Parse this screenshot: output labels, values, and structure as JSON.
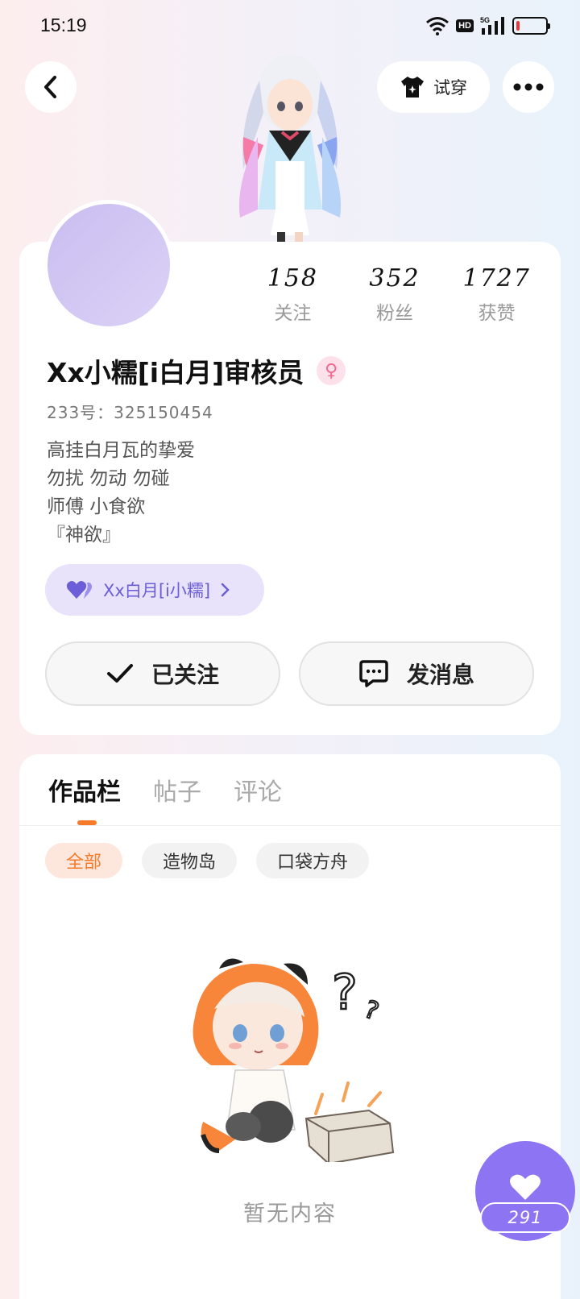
{
  "status_bar": {
    "time": "15:19",
    "network": "5G",
    "hd": "HD",
    "battery_level": 0.12
  },
  "header": {
    "back_icon": "chevron-left-icon",
    "tryon_label": "试穿",
    "tryon_icon": "tshirt-icon",
    "more_icon": "more-dots-icon"
  },
  "profile": {
    "stats": [
      {
        "value": "158",
        "label": "关注"
      },
      {
        "value": "352",
        "label": "粉丝"
      },
      {
        "value": "1727",
        "label": "获赞"
      }
    ],
    "username": "Xx小糯[i白月]审核员",
    "gender_icon": "female-icon",
    "uid": "233号：325150454",
    "bio": [
      "高挂白月瓦的挚爱",
      "勿扰 勿动 勿碰",
      "师傅 小食欲",
      "『神欲』"
    ],
    "relation_chip": {
      "label": "Xx白月[i小糯]",
      "icon": "double-heart-icon"
    },
    "follow_button": "已关注",
    "message_button": "发消息"
  },
  "content": {
    "tabs": [
      "作品栏",
      "帖子",
      "评论"
    ],
    "active_tab": 0,
    "filters": [
      "全部",
      "造物岛",
      "口袋方舟"
    ],
    "active_filter": 0,
    "empty_text": "暂无内容"
  },
  "like_fab": {
    "count": "291",
    "icon": "heart-icon"
  },
  "colors": {
    "accent_orange": "#f57a2a",
    "accent_purple": "#8c74f2",
    "gender_pink": "#f2668f"
  }
}
